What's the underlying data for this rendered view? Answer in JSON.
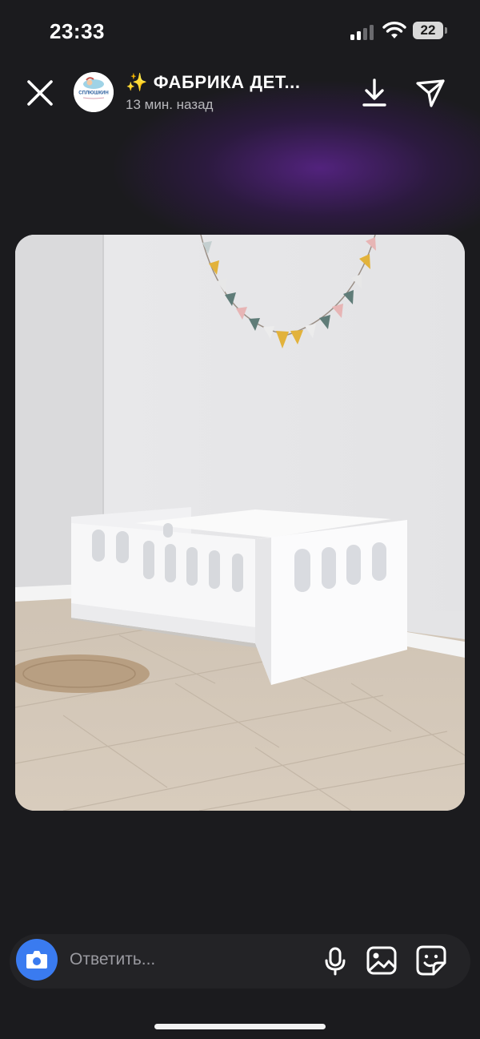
{
  "status_bar": {
    "time": "23:33",
    "battery": "22"
  },
  "header": {
    "account_name": "✨ ФАБРИКА ДЕТ...",
    "avatar_text": "СПЛЮШКИН",
    "post_time": "13 мин. назад"
  },
  "story": {
    "description": "white children's bed in a room with bunting"
  },
  "reply_bar": {
    "placeholder": "Ответить..."
  },
  "colors": {
    "accent": "#3a7bf0",
    "glow": "#55238a",
    "background": "#1a1a1c"
  },
  "icons": [
    "close-icon",
    "download-icon",
    "share-icon",
    "camera-icon",
    "microphone-icon",
    "gallery-icon",
    "sticker-icon",
    "signal-icon",
    "wifi-icon",
    "battery-icon"
  ]
}
